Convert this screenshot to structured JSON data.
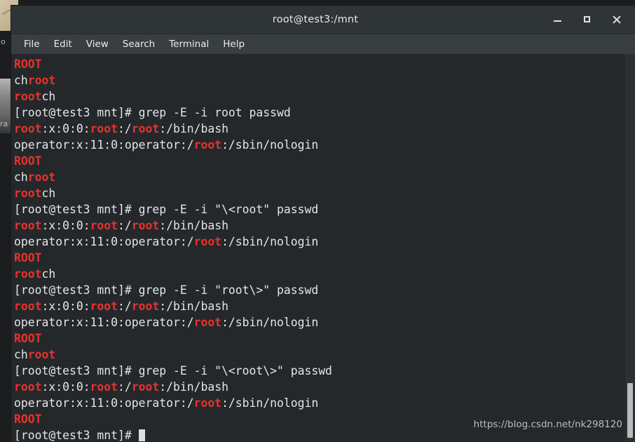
{
  "window": {
    "title": "root@test3:/mnt",
    "controls": {
      "minimize": "_",
      "maximize": "□",
      "close": "×"
    }
  },
  "menu": {
    "items": [
      {
        "label": "File"
      },
      {
        "label": "Edit"
      },
      {
        "label": "View"
      },
      {
        "label": "Search"
      },
      {
        "label": "Terminal"
      },
      {
        "label": "Help"
      }
    ]
  },
  "desktop": {
    "text_fragment_left_top": "o",
    "text_fragment_left_mid": "ra"
  },
  "terminal": {
    "prompt": "[root@test3 mnt]# ",
    "colors": {
      "background": "#24282b",
      "foreground": "#e4e6e7",
      "match_highlight": "#e8322b",
      "titlebar": "#2f3436",
      "menubar": "#383e41"
    },
    "lines": [
      {
        "segments": [
          {
            "t": "ROOT",
            "hl": true
          }
        ]
      },
      {
        "segments": [
          {
            "t": "ch",
            "hl": false
          },
          {
            "t": "root",
            "hl": true
          }
        ]
      },
      {
        "segments": [
          {
            "t": "root",
            "hl": true
          },
          {
            "t": "ch",
            "hl": false
          }
        ]
      },
      {
        "segments": [
          {
            "t": "[root@test3 mnt]# grep -E -i root passwd",
            "hl": false
          }
        ]
      },
      {
        "segments": [
          {
            "t": "root",
            "hl": true
          },
          {
            "t": ":x:0:0:",
            "hl": false
          },
          {
            "t": "root",
            "hl": true
          },
          {
            "t": ":/",
            "hl": false
          },
          {
            "t": "root",
            "hl": true
          },
          {
            "t": ":/bin/bash",
            "hl": false
          }
        ]
      },
      {
        "segments": [
          {
            "t": "operator:x:11:0:operator:/",
            "hl": false
          },
          {
            "t": "root",
            "hl": true
          },
          {
            "t": ":/sbin/nologin",
            "hl": false
          }
        ]
      },
      {
        "segments": [
          {
            "t": "ROOT",
            "hl": true
          }
        ]
      },
      {
        "segments": [
          {
            "t": "ch",
            "hl": false
          },
          {
            "t": "root",
            "hl": true
          }
        ]
      },
      {
        "segments": [
          {
            "t": "root",
            "hl": true
          },
          {
            "t": "ch",
            "hl": false
          }
        ]
      },
      {
        "segments": [
          {
            "t": "[root@test3 mnt]# grep -E -i \"\\<root\" passwd",
            "hl": false
          }
        ]
      },
      {
        "segments": [
          {
            "t": "root",
            "hl": true
          },
          {
            "t": ":x:0:0:",
            "hl": false
          },
          {
            "t": "root",
            "hl": true
          },
          {
            "t": ":/",
            "hl": false
          },
          {
            "t": "root",
            "hl": true
          },
          {
            "t": ":/bin/bash",
            "hl": false
          }
        ]
      },
      {
        "segments": [
          {
            "t": "operator:x:11:0:operator:/",
            "hl": false
          },
          {
            "t": "root",
            "hl": true
          },
          {
            "t": ":/sbin/nologin",
            "hl": false
          }
        ]
      },
      {
        "segments": [
          {
            "t": "ROOT",
            "hl": true
          }
        ]
      },
      {
        "segments": [
          {
            "t": "root",
            "hl": true
          },
          {
            "t": "ch",
            "hl": false
          }
        ]
      },
      {
        "segments": [
          {
            "t": "[root@test3 mnt]# grep -E -i \"root\\>\" passwd",
            "hl": false
          }
        ]
      },
      {
        "segments": [
          {
            "t": "root",
            "hl": true
          },
          {
            "t": ":x:0:0:",
            "hl": false
          },
          {
            "t": "root",
            "hl": true
          },
          {
            "t": ":/",
            "hl": false
          },
          {
            "t": "root",
            "hl": true
          },
          {
            "t": ":/bin/bash",
            "hl": false
          }
        ]
      },
      {
        "segments": [
          {
            "t": "operator:x:11:0:operator:/",
            "hl": false
          },
          {
            "t": "root",
            "hl": true
          },
          {
            "t": ":/sbin/nologin",
            "hl": false
          }
        ]
      },
      {
        "segments": [
          {
            "t": "ROOT",
            "hl": true
          }
        ]
      },
      {
        "segments": [
          {
            "t": "ch",
            "hl": false
          },
          {
            "t": "root",
            "hl": true
          }
        ]
      },
      {
        "segments": [
          {
            "t": "[root@test3 mnt]# grep -E -i \"\\<root\\>\" passwd",
            "hl": false
          }
        ]
      },
      {
        "segments": [
          {
            "t": "root",
            "hl": true
          },
          {
            "t": ":x:0:0:",
            "hl": false
          },
          {
            "t": "root",
            "hl": true
          },
          {
            "t": ":/",
            "hl": false
          },
          {
            "t": "root",
            "hl": true
          },
          {
            "t": ":/bin/bash",
            "hl": false
          }
        ]
      },
      {
        "segments": [
          {
            "t": "operator:x:11:0:operator:/",
            "hl": false
          },
          {
            "t": "root",
            "hl": true
          },
          {
            "t": ":/sbin/nologin",
            "hl": false
          }
        ]
      },
      {
        "segments": [
          {
            "t": "ROOT",
            "hl": true
          }
        ]
      },
      {
        "segments": [
          {
            "t": "[root@test3 mnt]# ",
            "hl": false
          }
        ],
        "cursor": true
      }
    ]
  },
  "watermark": {
    "text": "https://blog.csdn.net/nk298120"
  }
}
